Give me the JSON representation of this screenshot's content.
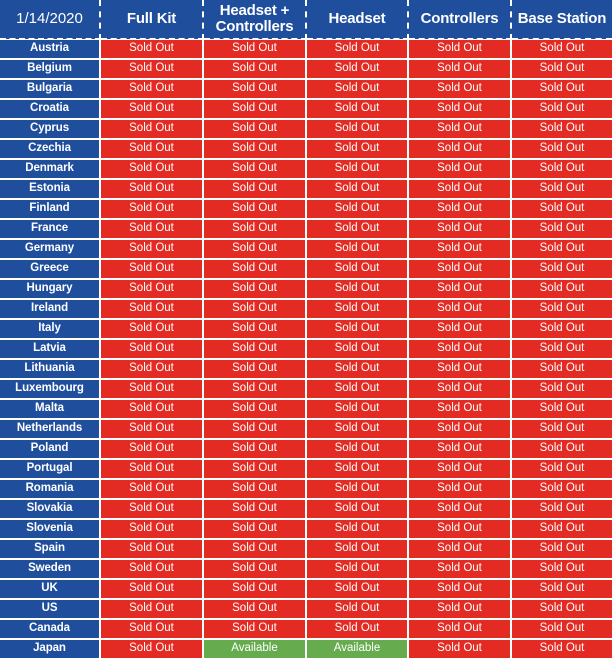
{
  "table": {
    "date_label": "1/14/2020",
    "columns": [
      "Full Kit",
      "Headset + Controllers",
      "Headset",
      "Controllers",
      "Base Station"
    ],
    "status_labels": {
      "sold_out": "Sold Out",
      "available": "Available"
    },
    "colors": {
      "header_blue": "#1f4e9c",
      "country_blue": "#1f4e9c",
      "sold_out_red": "#e32b24",
      "available_green": "#66ab4e",
      "border_white": "#ffffff",
      "text_white": "#ffffff"
    },
    "rows": [
      {
        "country": "Austria",
        "cells": [
          "Sold Out",
          "Sold Out",
          "Sold Out",
          "Sold Out",
          "Sold Out"
        ]
      },
      {
        "country": "Belgium",
        "cells": [
          "Sold Out",
          "Sold Out",
          "Sold Out",
          "Sold Out",
          "Sold Out"
        ]
      },
      {
        "country": "Bulgaria",
        "cells": [
          "Sold Out",
          "Sold Out",
          "Sold Out",
          "Sold Out",
          "Sold Out"
        ]
      },
      {
        "country": "Croatia",
        "cells": [
          "Sold Out",
          "Sold Out",
          "Sold Out",
          "Sold Out",
          "Sold Out"
        ]
      },
      {
        "country": "Cyprus",
        "cells": [
          "Sold Out",
          "Sold Out",
          "Sold Out",
          "Sold Out",
          "Sold Out"
        ]
      },
      {
        "country": "Czechia",
        "cells": [
          "Sold Out",
          "Sold Out",
          "Sold Out",
          "Sold Out",
          "Sold Out"
        ]
      },
      {
        "country": "Denmark",
        "cells": [
          "Sold Out",
          "Sold Out",
          "Sold Out",
          "Sold Out",
          "Sold Out"
        ]
      },
      {
        "country": "Estonia",
        "cells": [
          "Sold Out",
          "Sold Out",
          "Sold Out",
          "Sold Out",
          "Sold Out"
        ]
      },
      {
        "country": "Finland",
        "cells": [
          "Sold Out",
          "Sold Out",
          "Sold Out",
          "Sold Out",
          "Sold Out"
        ]
      },
      {
        "country": "France",
        "cells": [
          "Sold Out",
          "Sold Out",
          "Sold Out",
          "Sold Out",
          "Sold Out"
        ]
      },
      {
        "country": "Germany",
        "cells": [
          "Sold Out",
          "Sold Out",
          "Sold Out",
          "Sold Out",
          "Sold Out"
        ]
      },
      {
        "country": "Greece",
        "cells": [
          "Sold Out",
          "Sold Out",
          "Sold Out",
          "Sold Out",
          "Sold Out"
        ]
      },
      {
        "country": "Hungary",
        "cells": [
          "Sold Out",
          "Sold Out",
          "Sold Out",
          "Sold Out",
          "Sold Out"
        ]
      },
      {
        "country": "Ireland",
        "cells": [
          "Sold Out",
          "Sold Out",
          "Sold Out",
          "Sold Out",
          "Sold Out"
        ]
      },
      {
        "country": "Italy",
        "cells": [
          "Sold Out",
          "Sold Out",
          "Sold Out",
          "Sold Out",
          "Sold Out"
        ]
      },
      {
        "country": "Latvia",
        "cells": [
          "Sold Out",
          "Sold Out",
          "Sold Out",
          "Sold Out",
          "Sold Out"
        ]
      },
      {
        "country": "Lithuania",
        "cells": [
          "Sold Out",
          "Sold Out",
          "Sold Out",
          "Sold Out",
          "Sold Out"
        ]
      },
      {
        "country": "Luxembourg",
        "cells": [
          "Sold Out",
          "Sold Out",
          "Sold Out",
          "Sold Out",
          "Sold Out"
        ]
      },
      {
        "country": "Malta",
        "cells": [
          "Sold Out",
          "Sold Out",
          "Sold Out",
          "Sold Out",
          "Sold Out"
        ]
      },
      {
        "country": "Netherlands",
        "cells": [
          "Sold Out",
          "Sold Out",
          "Sold Out",
          "Sold Out",
          "Sold Out"
        ]
      },
      {
        "country": "Poland",
        "cells": [
          "Sold Out",
          "Sold Out",
          "Sold Out",
          "Sold Out",
          "Sold Out"
        ]
      },
      {
        "country": "Portugal",
        "cells": [
          "Sold Out",
          "Sold Out",
          "Sold Out",
          "Sold Out",
          "Sold Out"
        ]
      },
      {
        "country": "Romania",
        "cells": [
          "Sold Out",
          "Sold Out",
          "Sold Out",
          "Sold Out",
          "Sold Out"
        ]
      },
      {
        "country": "Slovakia",
        "cells": [
          "Sold Out",
          "Sold Out",
          "Sold Out",
          "Sold Out",
          "Sold Out"
        ]
      },
      {
        "country": "Slovenia",
        "cells": [
          "Sold Out",
          "Sold Out",
          "Sold Out",
          "Sold Out",
          "Sold Out"
        ]
      },
      {
        "country": "Spain",
        "cells": [
          "Sold Out",
          "Sold Out",
          "Sold Out",
          "Sold Out",
          "Sold Out"
        ]
      },
      {
        "country": "Sweden",
        "cells": [
          "Sold Out",
          "Sold Out",
          "Sold Out",
          "Sold Out",
          "Sold Out"
        ]
      },
      {
        "country": "UK",
        "cells": [
          "Sold Out",
          "Sold Out",
          "Sold Out",
          "Sold Out",
          "Sold Out"
        ]
      },
      {
        "country": "US",
        "cells": [
          "Sold Out",
          "Sold Out",
          "Sold Out",
          "Sold Out",
          "Sold Out"
        ]
      },
      {
        "country": "Canada",
        "cells": [
          "Sold Out",
          "Sold Out",
          "Sold Out",
          "Sold Out",
          "Sold Out"
        ]
      },
      {
        "country": "Japan",
        "cells": [
          "Sold Out",
          "Available",
          "Available",
          "Sold Out",
          "Sold Out"
        ]
      }
    ]
  }
}
